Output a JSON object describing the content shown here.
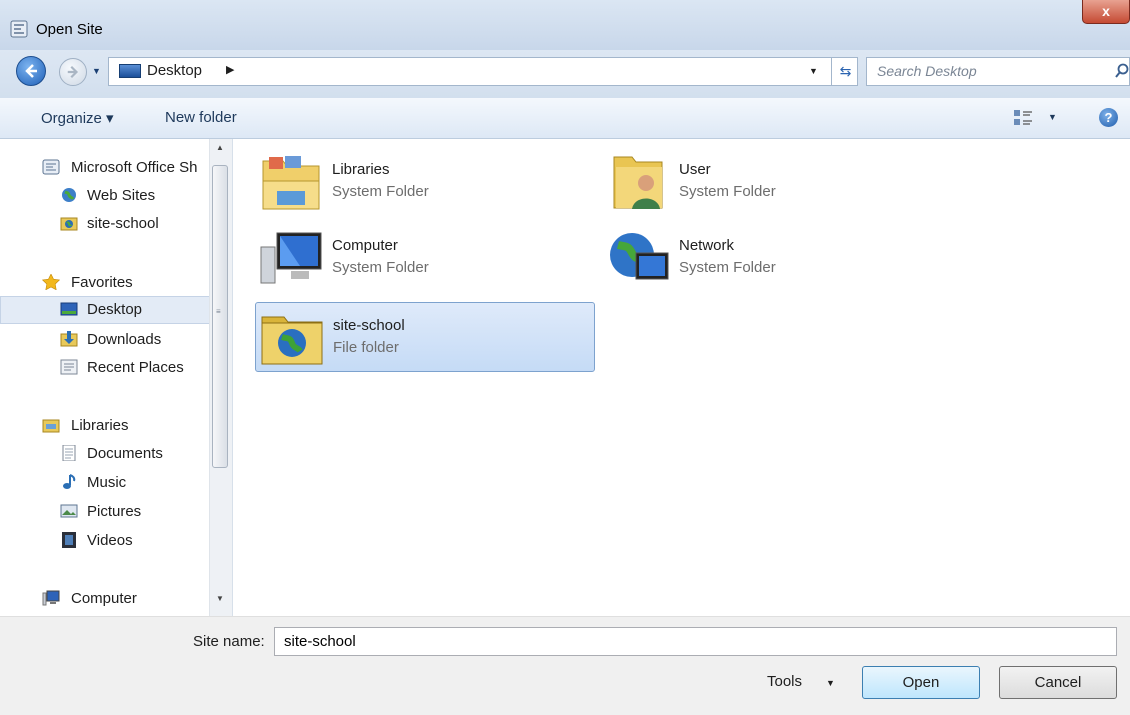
{
  "window": {
    "title": "Open Site",
    "close_label": "x"
  },
  "address": {
    "location": "Desktop",
    "search_placeholder": "Search Desktop"
  },
  "toolbar": {
    "organize": "Organize ▾",
    "new_folder": "New folder",
    "help": "?"
  },
  "nav": {
    "items": [
      {
        "label": "Microsoft Office Sh",
        "icon": "office-server-icon"
      },
      {
        "label": "Web Sites",
        "icon": "globe-icon"
      },
      {
        "label": "site-school",
        "icon": "web-folder-icon"
      },
      {
        "label": "Favorites",
        "icon": "star-icon"
      },
      {
        "label": "Desktop",
        "icon": "desktop-icon",
        "selected": true
      },
      {
        "label": "Downloads",
        "icon": "downloads-icon"
      },
      {
        "label": "Recent Places",
        "icon": "recent-places-icon"
      },
      {
        "label": "Libraries",
        "icon": "libraries-icon"
      },
      {
        "label": "Documents",
        "icon": "documents-icon"
      },
      {
        "label": "Music",
        "icon": "music-icon"
      },
      {
        "label": "Pictures",
        "icon": "pictures-icon"
      },
      {
        "label": "Videos",
        "icon": "videos-icon"
      },
      {
        "label": "Computer",
        "icon": "computer-icon"
      }
    ]
  },
  "content": {
    "items": [
      {
        "name": "Libraries",
        "type": "System Folder",
        "icon": "libraries-folder-icon"
      },
      {
        "name": "User",
        "type": "System Folder",
        "icon": "user-folder-icon"
      },
      {
        "name": "Computer",
        "type": "System Folder",
        "icon": "computer-icon"
      },
      {
        "name": "Network",
        "type": "System Folder",
        "icon": "network-icon"
      },
      {
        "name": "site-school",
        "type": "File folder",
        "icon": "web-folder-icon",
        "selected": true
      }
    ]
  },
  "footer": {
    "site_name_label": "Site name:",
    "site_name_value": "site-school",
    "tools_label": "Tools",
    "open_label": "Open",
    "cancel_label": "Cancel"
  },
  "colors": {
    "selection": "#cfe0f7",
    "title_bar": "#d2dfee",
    "close": "#c54a33"
  }
}
